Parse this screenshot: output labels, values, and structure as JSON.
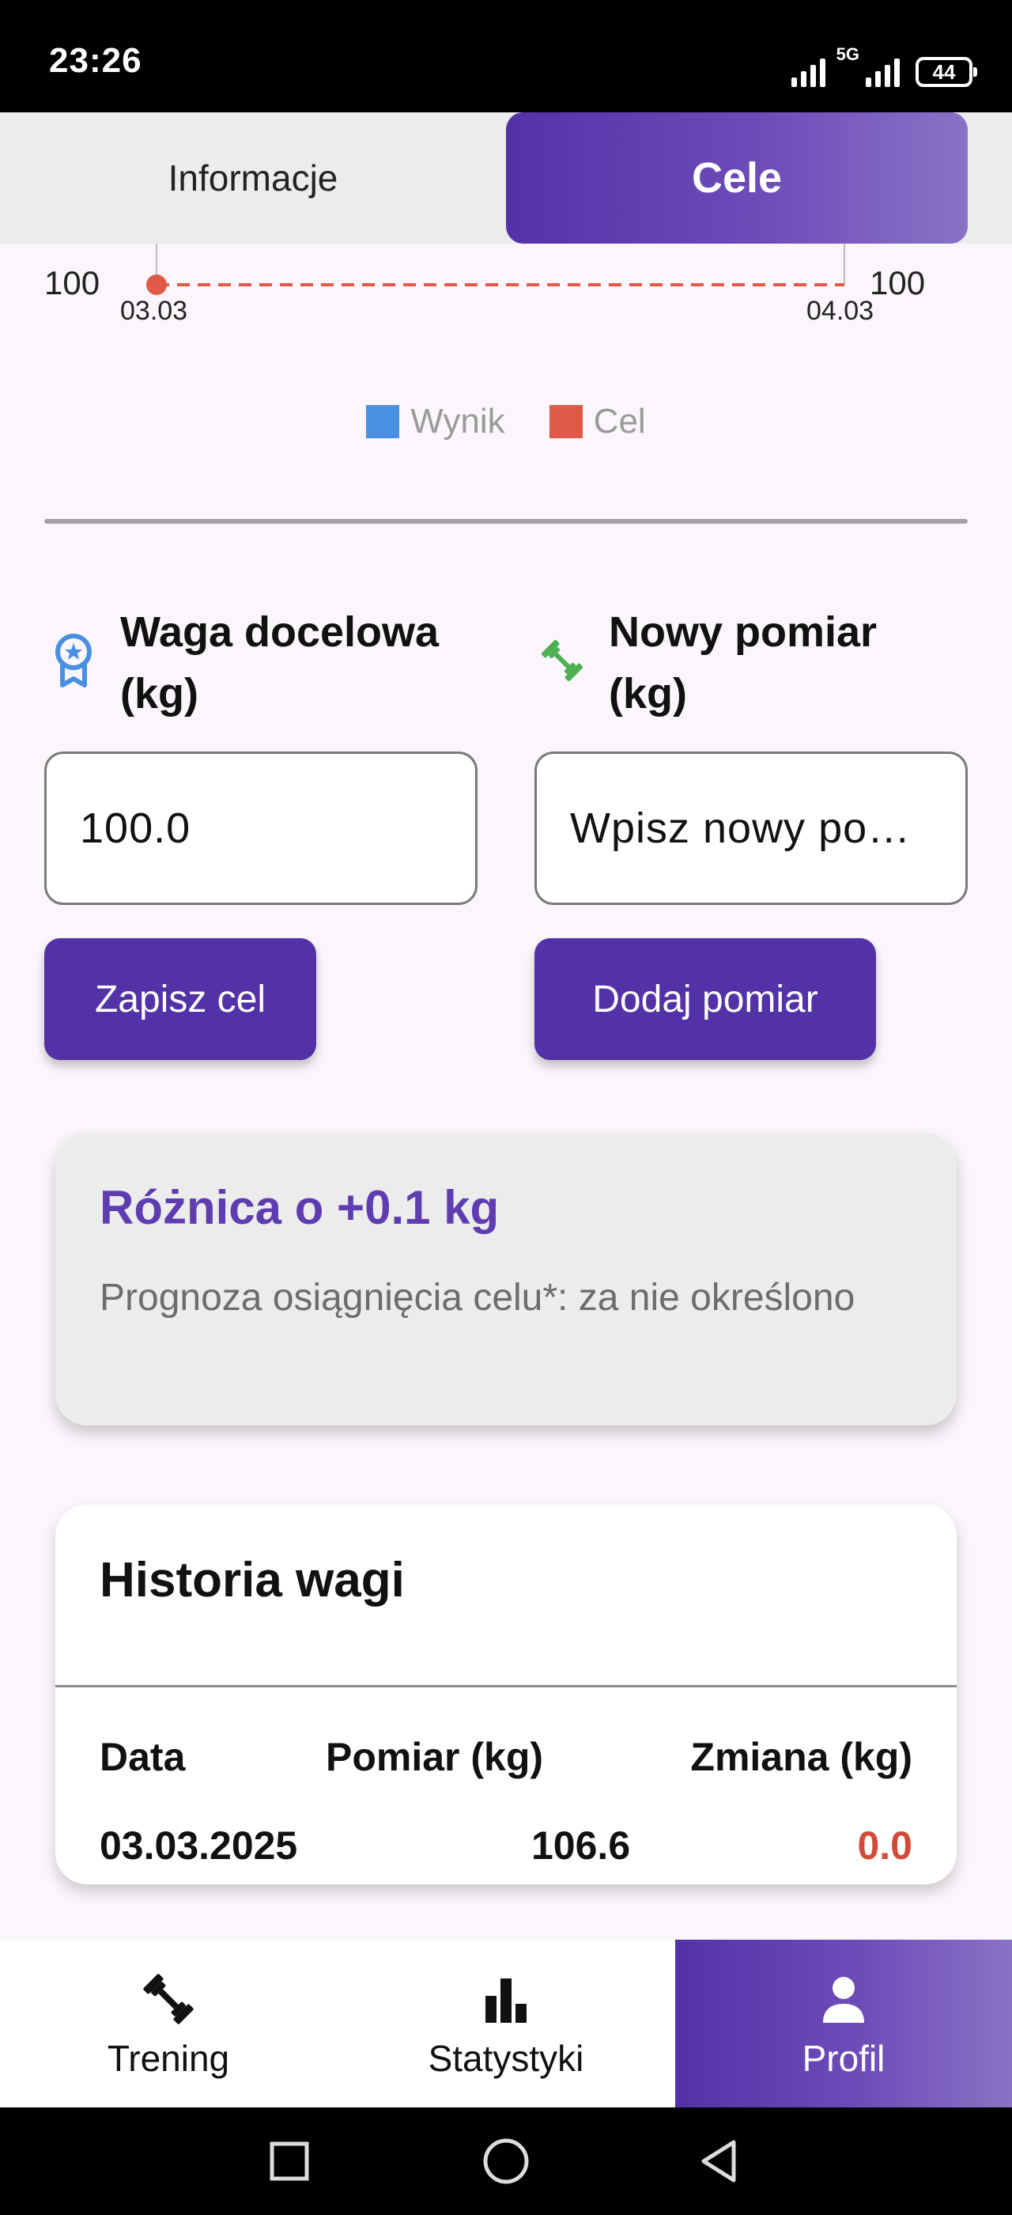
{
  "status_bar": {
    "time": "23:26",
    "network": "5G",
    "battery": "44"
  },
  "tabs": [
    {
      "label": "Informacje",
      "active": false
    },
    {
      "label": "Cele",
      "active": true
    }
  ],
  "chart_data": {
    "type": "line",
    "x": [
      "03.03",
      "04.03"
    ],
    "y_left_tick": "100",
    "y_right_tick": "100",
    "series": [
      {
        "name": "Wynik",
        "color": "#4a90e2",
        "values": []
      },
      {
        "name": "Cel",
        "color": "#e05a47",
        "values": [
          100,
          100
        ],
        "style": "dashed"
      }
    ],
    "legend": [
      "Wynik",
      "Cel"
    ],
    "legend_position": "bottom-center"
  },
  "goal": {
    "label": "Waga docelowa (kg)",
    "label_line1": "Waga docelowa",
    "label_line2": "(kg)",
    "value": "100.0",
    "button": "Zapisz cel",
    "icon": "award-ribbon-icon"
  },
  "measure": {
    "label": "Nowy pomiar (kg)",
    "label_line1": "Nowy pomiar",
    "label_line2": "(kg)",
    "placeholder": "Wpisz nowy po…",
    "button": "Dodaj pomiar",
    "icon": "dumbbell-icon"
  },
  "summary": {
    "title": "Różnica o +0.1 kg",
    "forecast": "Prognoza osiągnięcia celu*: za nie określono"
  },
  "history": {
    "title": "Historia wagi",
    "columns": [
      "Data",
      "Pomiar (kg)",
      "Zmiana (kg)"
    ],
    "rows": [
      {
        "date": "03.03.2025",
        "measurement": "106.6",
        "change": "0.0"
      }
    ],
    "change_color": "#d24a3a"
  },
  "bottom_nav": [
    {
      "label": "Trening",
      "icon": "dumbbell-icon",
      "active": false
    },
    {
      "label": "Statystyki",
      "icon": "bar-chart-icon",
      "active": false
    },
    {
      "label": "Profil",
      "icon": "person-icon",
      "active": true
    }
  ],
  "colors": {
    "accent": "#5331a7",
    "accent_text": "#5f3cb0"
  }
}
